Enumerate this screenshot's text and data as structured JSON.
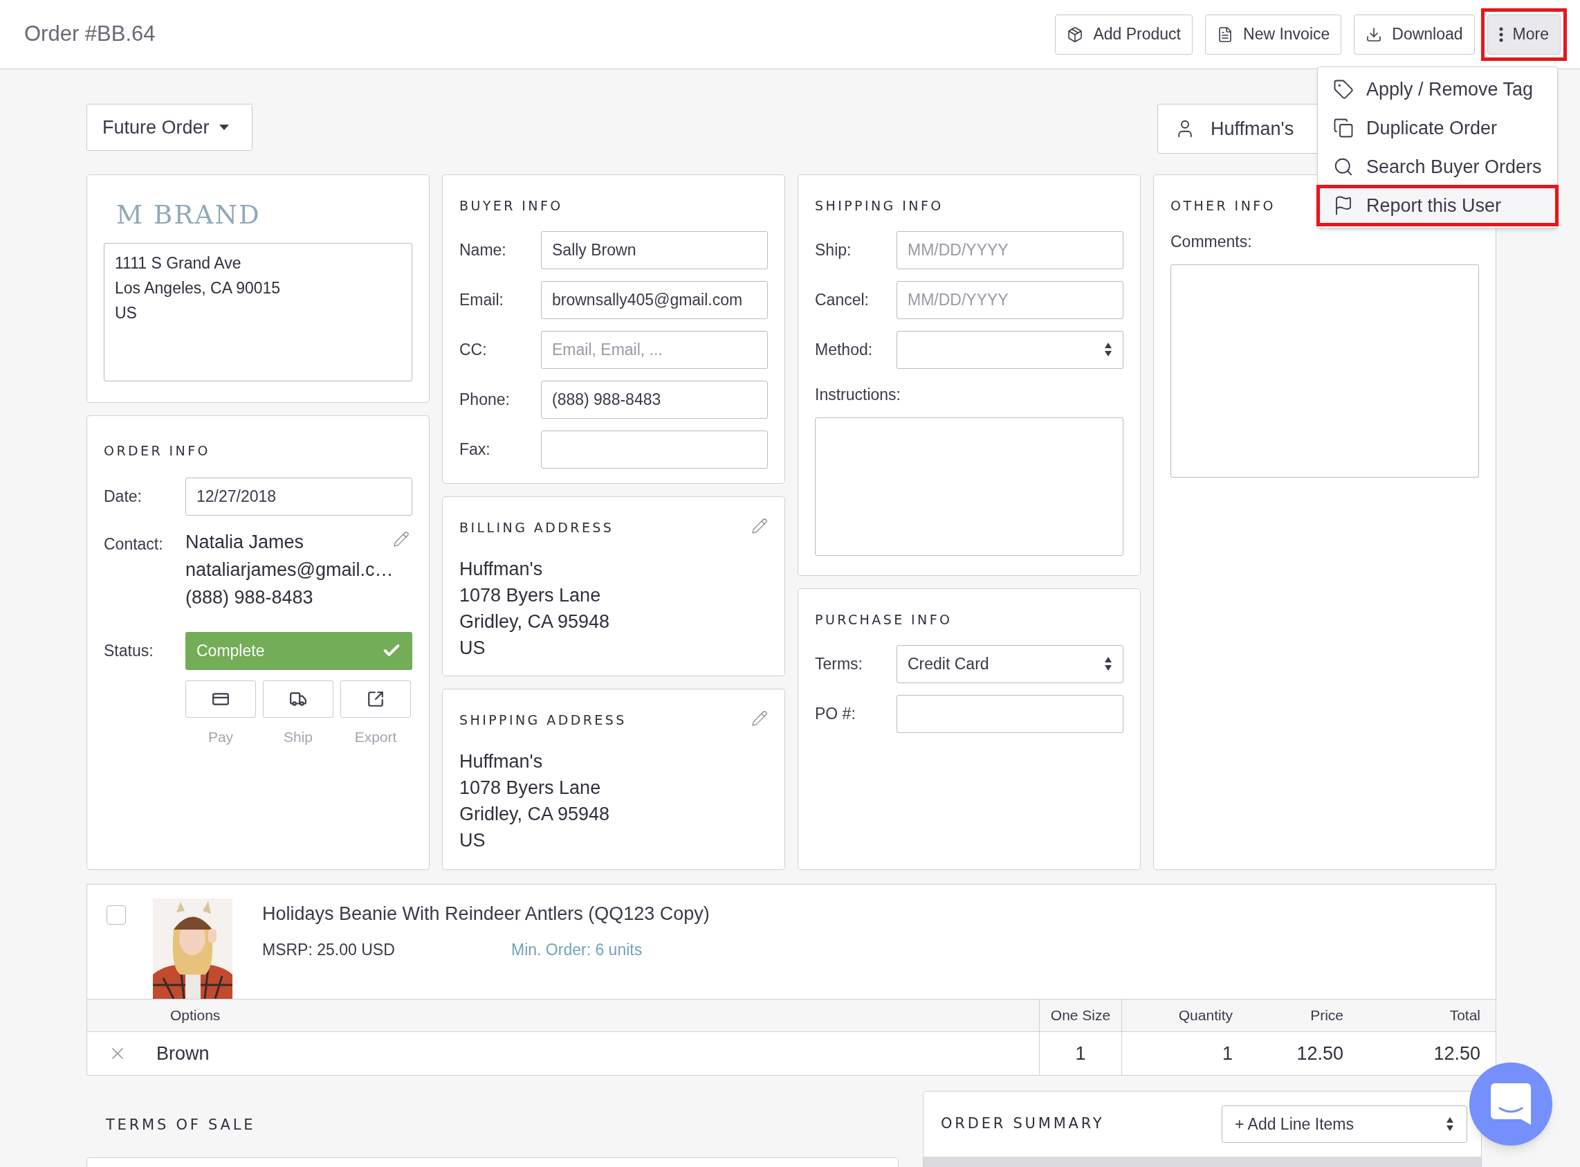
{
  "header": {
    "title": "Order #BB.64",
    "actions": [
      {
        "label": "Add Product",
        "active": false,
        "highlighted": false
      },
      {
        "label": "New Invoice",
        "active": false,
        "highlighted": false
      },
      {
        "label": "Download",
        "active": false,
        "highlighted": false
      },
      {
        "label": "More",
        "active": true,
        "highlighted": true
      }
    ]
  },
  "more_menu": [
    {
      "label": "Apply / Remove Tag",
      "highlighted": false
    },
    {
      "label": "Duplicate Order",
      "highlighted": false
    },
    {
      "label": "Search Buyer Orders",
      "highlighted": false
    },
    {
      "label": "Report this User",
      "highlighted": true
    }
  ],
  "order_type": "Future Order",
  "buyer_button": "Huffman's",
  "brand": {
    "logo": "M BRAND",
    "address": [
      "1111 S Grand Ave",
      "Los Angeles, CA 90015",
      "US"
    ]
  },
  "order_info": {
    "title": "ORDER INFO",
    "date_label": "Date:",
    "date": "12/27/2018",
    "contact_label": "Contact:",
    "contact": [
      "Natalia James",
      "nataliarjames@gmail.c…",
      "(888) 988-8483"
    ],
    "status_label": "Status:",
    "status": "Complete",
    "actions": [
      "Pay",
      "Ship",
      "Export"
    ]
  },
  "buyer_info": {
    "title": "BUYER INFO",
    "fields": [
      {
        "label": "Name:",
        "value": "Sally Brown"
      },
      {
        "label": "Email:",
        "value": "brownsally405@gmail.com"
      },
      {
        "label": "CC:",
        "placeholder": "Email, Email, ..."
      },
      {
        "label": "Phone:",
        "value": "(888) 988-8483"
      },
      {
        "label": "Fax:"
      }
    ]
  },
  "billing_address": {
    "title": "BILLING ADDRESS",
    "lines": [
      "Huffman's",
      "1078 Byers Lane",
      "Gridley, CA 95948",
      "US"
    ]
  },
  "shipping_address": {
    "title": "SHIPPING ADDRESS",
    "lines": [
      "Huffman's",
      "1078 Byers Lane",
      "Gridley, CA 95948",
      "US"
    ]
  },
  "shipping_info": {
    "title": "SHIPPING INFO",
    "fields": [
      {
        "kind": "text",
        "label": "Ship:",
        "placeholder": "MM/DD/YYYY"
      },
      {
        "kind": "text",
        "label": "Cancel:",
        "placeholder": "MM/DD/YYYY"
      },
      {
        "kind": "select",
        "label": "Method:"
      }
    ],
    "instructions_label": "Instructions:"
  },
  "purchase_info": {
    "title": "PURCHASE INFO",
    "fields": [
      {
        "kind": "select",
        "label": "Terms:",
        "value": "Credit Card"
      },
      {
        "kind": "text",
        "label": "PO #:"
      }
    ]
  },
  "other_info": {
    "title": "OTHER INFO",
    "comments_label": "Comments:"
  },
  "product": {
    "checked": false,
    "name": "Holidays Beanie With Reindeer Antlers (QQ123 Copy)",
    "msrp": "MSRP: 25.00 USD",
    "min_order": "Min. Order: 6 units",
    "columns": [
      "Options",
      "One Size",
      "Quantity",
      "Price",
      "Total"
    ],
    "rows": [
      {
        "option": "Brown",
        "one_size": "1",
        "quantity": "1",
        "price": "12.50",
        "total": "12.50"
      }
    ]
  },
  "terms_of_sale": {
    "title": "TERMS OF SALE"
  },
  "order_summary": {
    "title": "ORDER SUMMARY",
    "add_select": "+ Add Line Items"
  }
}
